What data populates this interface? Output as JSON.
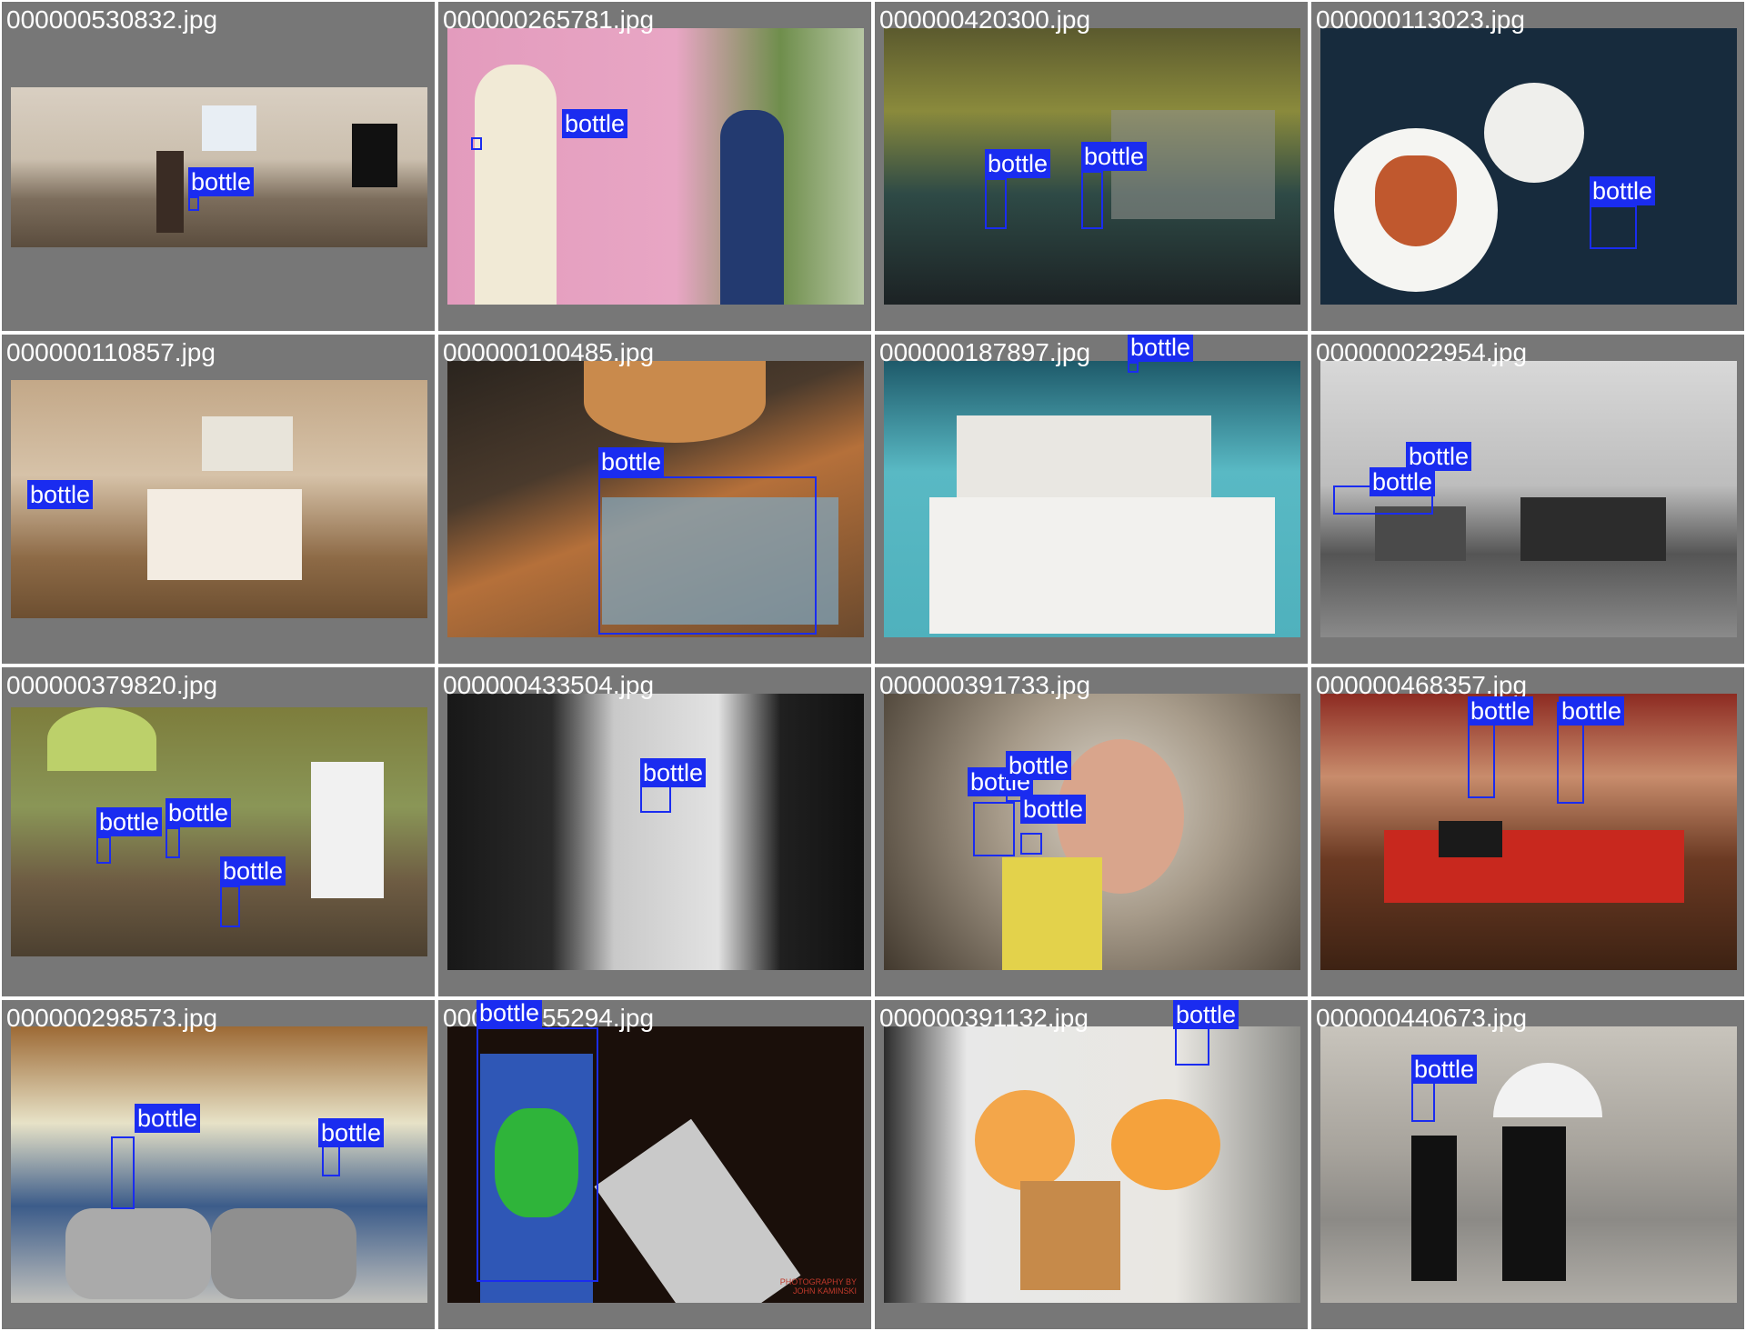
{
  "grid": {
    "tiles": [
      {
        "filename": "000000530832.jpg",
        "detections": [
          {
            "label": "bottle"
          }
        ],
        "scene": "kitchen panorama"
      },
      {
        "filename": "000000265781.jpg",
        "detections": [
          {
            "label": "bottle"
          }
        ],
        "scene": "pink food truck"
      },
      {
        "filename": "000000420300.jpg",
        "detections": [
          {
            "label": "bottle"
          },
          {
            "label": "bottle"
          }
        ],
        "scene": "kitchen sink"
      },
      {
        "filename": "000000113023.jpg",
        "detections": [
          {
            "label": "bottle"
          }
        ],
        "scene": "pizza table"
      },
      {
        "filename": "000000110857.jpg",
        "detections": [
          {
            "label": "bottle"
          }
        ],
        "scene": "hotel room"
      },
      {
        "filename": "000000100485.jpg",
        "detections": [
          {
            "label": "bottle"
          }
        ],
        "scene": "dog with bottle"
      },
      {
        "filename": "000000187897.jpg",
        "detections": [
          {
            "label": "bottle"
          }
        ],
        "scene": "sushi plate"
      },
      {
        "filename": "000000022954.jpg",
        "detections": [
          {
            "label": "bottle"
          },
          {
            "label": "bottle"
          }
        ],
        "scene": "grey kitchen"
      },
      {
        "filename": "000000379820.jpg",
        "detections": [
          {
            "label": "bottle"
          },
          {
            "label": "bottle"
          },
          {
            "label": "bottle"
          }
        ],
        "scene": "picnic"
      },
      {
        "filename": "000000433504.jpg",
        "detections": [
          {
            "label": "bottle"
          }
        ],
        "scene": "bw kitchen"
      },
      {
        "filename": "000000391733.jpg",
        "detections": [
          {
            "label": "bottle"
          },
          {
            "label": "bottle"
          },
          {
            "label": "bottle"
          }
        ],
        "scene": "fridge"
      },
      {
        "filename": "000000468357.jpg",
        "detections": [
          {
            "label": "bottle"
          },
          {
            "label": "bottle"
          }
        ],
        "scene": "red laptop table"
      },
      {
        "filename": "000000298573.jpg",
        "detections": [
          {
            "label": "bottle"
          },
          {
            "label": "bottle"
          }
        ],
        "scene": "sink"
      },
      {
        "filename": "000000155294.jpg",
        "detections": [
          {
            "label": "bottle"
          }
        ],
        "scene": "beer and remote"
      },
      {
        "filename": "000000391132.jpg",
        "detections": [
          {
            "label": "bottle"
          }
        ],
        "scene": "kitchen overhead"
      },
      {
        "filename": "000000440673.jpg",
        "detections": [
          {
            "label": "bottle"
          }
        ],
        "scene": "street"
      }
    ]
  },
  "image_text": {
    "watermark": "PHOTOGRAPHY BY\nJOHN KAMINSKI"
  },
  "colors": {
    "tile_background": "#777777",
    "box": "#1a2cf0",
    "label_text": "#ffffff"
  }
}
